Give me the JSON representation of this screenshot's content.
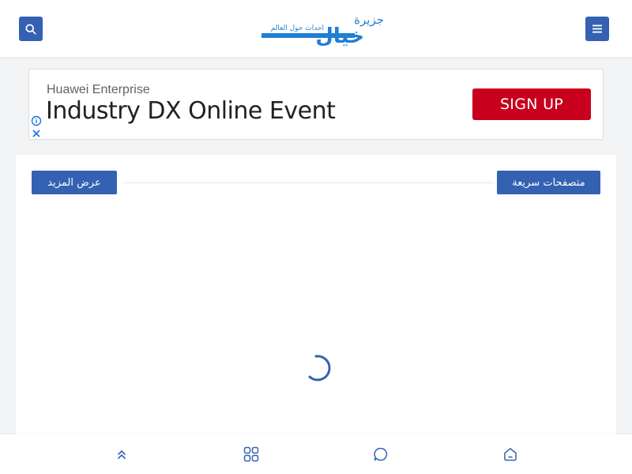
{
  "header": {
    "search_icon": "search-icon",
    "menu_icon": "hamburger-menu-icon",
    "logo": {
      "line1": "جزيرة",
      "line2": "خيال",
      "tagline": "احداث حول العالم"
    }
  },
  "ad": {
    "brand": "Huawei Enterprise",
    "title": "Industry DX Online Event",
    "cta_label": "SIGN UP",
    "info_icon": "info-icon",
    "close_icon": "close-icon"
  },
  "section": {
    "title": "متصفحات سريعة",
    "more_label": "عرض المزيد",
    "loading_icon": "loading-spinner-icon"
  },
  "bottom_nav": {
    "items": [
      {
        "icon": "double-chevron-up-icon"
      },
      {
        "icon": "grid-icon"
      },
      {
        "icon": "chat-bubble-icon"
      },
      {
        "icon": "home-icon"
      }
    ]
  },
  "colors": {
    "accent": "#3461b2",
    "ad_cta": "#c8001e",
    "logo_blue": "#1f7fd4"
  }
}
